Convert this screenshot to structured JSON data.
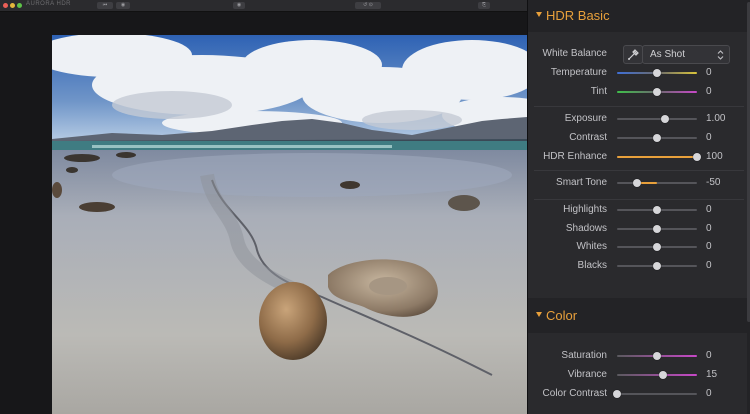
{
  "toolbar": {
    "app_title": "AURORA HDR",
    "btn1": "⏮︎",
    "btn2": "◉",
    "btn3": "↺ ⊙",
    "btn4": "⎘"
  },
  "photo": {
    "description_icon": "landscape-photo"
  },
  "panel": {
    "hdr_basic": {
      "title": "HDR Basic",
      "white_balance": {
        "label": "White Balance",
        "value": "As Shot"
      },
      "sliders_group1": [
        {
          "label": "Temperature",
          "value": "0",
          "level": 0.5,
          "track": "temp"
        },
        {
          "label": "Tint",
          "value": "0",
          "level": 0.5,
          "track": "tint"
        }
      ],
      "sliders_group2": [
        {
          "label": "Exposure",
          "value": "1.00",
          "level": 0.6,
          "track": "plain"
        },
        {
          "label": "Contrast",
          "value": "0",
          "level": 0.5,
          "track": "plain"
        },
        {
          "label": "HDR Enhance",
          "value": "100",
          "level": 1.0,
          "track": "orange"
        }
      ],
      "sliders_group3": [
        {
          "label": "Smart Tone",
          "value": "-50",
          "level": 0.25,
          "track": "orange-neg"
        }
      ],
      "sliders_group4": [
        {
          "label": "Highlights",
          "value": "0",
          "level": 0.5,
          "track": "plain"
        },
        {
          "label": "Shadows",
          "value": "0",
          "level": 0.5,
          "track": "plain"
        },
        {
          "label": "Whites",
          "value": "0",
          "level": 0.5,
          "track": "plain"
        },
        {
          "label": "Blacks",
          "value": "0",
          "level": 0.5,
          "track": "plain"
        }
      ]
    },
    "color": {
      "title": "Color",
      "sliders": [
        {
          "label": "Saturation",
          "value": "0",
          "level": 0.5,
          "track": "sat"
        },
        {
          "label": "Vibrance",
          "value": "15",
          "level": 0.575,
          "track": "sat"
        },
        {
          "label": "Color Contrast",
          "value": "0",
          "level": 0.0,
          "track": "plain"
        }
      ]
    }
  },
  "colors": {
    "accent": "#e8a03b",
    "panel_bg": "#2a2a2d"
  }
}
